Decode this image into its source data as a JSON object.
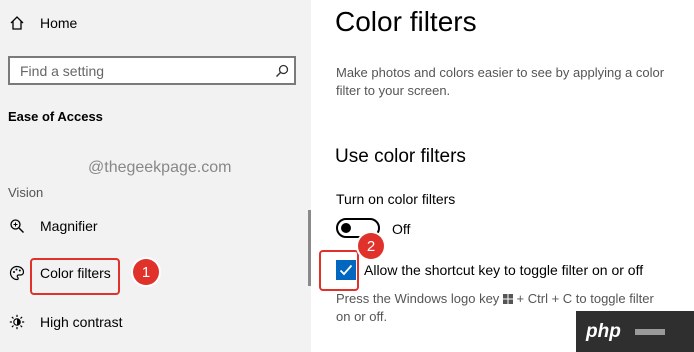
{
  "sidebar": {
    "home_label": "Home",
    "search_placeholder": "Find a setting",
    "section_title": "Ease of Access",
    "group_label": "Vision",
    "items": [
      {
        "label": "Magnifier",
        "icon": "magnifier-icon"
      },
      {
        "label": "Color filters",
        "icon": "palette-icon"
      },
      {
        "label": "High contrast",
        "icon": "brightness-icon"
      }
    ]
  },
  "watermark": "@thegeekpage.com",
  "main": {
    "title": "Color filters",
    "description_line1": "Make photos and colors easier to see by applying a color",
    "description_line2": "filter to your screen.",
    "section_heading": "Use color filters",
    "toggle": {
      "label": "Turn on color filters",
      "state_text": "Off"
    },
    "checkbox": {
      "label": "Allow the shortcut key to toggle filter on or off",
      "checked": true
    },
    "hint_line1_a": "Press the Windows logo key",
    "hint_line1_b": "+ Ctrl + C to toggle filter",
    "hint_line2": "on or off."
  },
  "annotations": {
    "badge1": "1",
    "badge2": "2"
  },
  "logo": {
    "text": "php"
  },
  "colors": {
    "accent": "#0067c0",
    "annotation": "#e0312b",
    "sidebar_bg": "#f2f2f2"
  }
}
